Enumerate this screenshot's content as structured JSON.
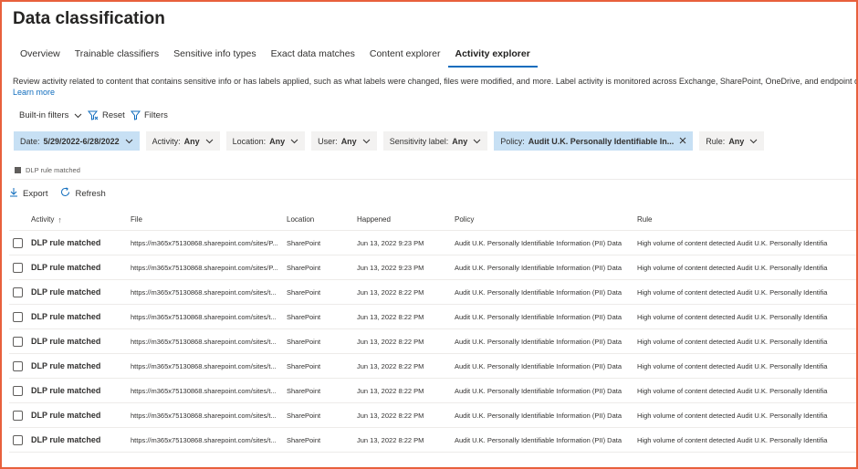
{
  "page": {
    "title": "Data classification",
    "description": "Review activity related to content that contains sensitive info or has labels applied, such as what labels were changed, files were modified, and more. Label activity is monitored across Exchange, SharePoint, OneDrive, and endpoint devices.",
    "learn_more": "Learn more"
  },
  "tabs": [
    {
      "label": "Overview"
    },
    {
      "label": "Trainable classifiers"
    },
    {
      "label": "Sensitive info types"
    },
    {
      "label": "Exact data matches"
    },
    {
      "label": "Content explorer"
    },
    {
      "label": "Activity explorer",
      "active": true
    }
  ],
  "commands": {
    "builtin_filters": "Built-in filters",
    "reset": "Reset",
    "filters": "Filters"
  },
  "filter_chips": [
    {
      "label": "Date:",
      "value": "5/29/2022-6/28/2022",
      "selected": true,
      "icon": "chevron-down-icon"
    },
    {
      "label": "Activity:",
      "value": "Any",
      "selected": false,
      "icon": "chevron-down-icon"
    },
    {
      "label": "Location:",
      "value": "Any",
      "selected": false,
      "icon": "chevron-down-icon"
    },
    {
      "label": "User:",
      "value": "Any",
      "selected": false,
      "icon": "chevron-down-icon"
    },
    {
      "label": "Sensitivity label:",
      "value": "Any",
      "selected": false,
      "icon": "chevron-down-icon"
    },
    {
      "label": "Policy:",
      "value": "Audit U.K. Personally Identifiable In...",
      "selected": true,
      "icon": "close-icon"
    },
    {
      "label": "Rule:",
      "value": "Any",
      "selected": false,
      "icon": "chevron-down-icon"
    }
  ],
  "legend": {
    "label": "DLP rule matched"
  },
  "toolbar": {
    "export": "Export",
    "refresh": "Refresh"
  },
  "table": {
    "columns": [
      "Activity",
      "File",
      "Location",
      "Happened",
      "Policy",
      "Rule"
    ],
    "rows": [
      {
        "activity": "DLP rule matched",
        "file": "https://m365x75130868.sharepoint.com/sites/P...",
        "location": "SharePoint",
        "happened": "Jun 13, 2022 9:23 PM",
        "policy": "Audit U.K. Personally Identifiable Information (PII) Data",
        "rule": "High volume of content detected Audit U.K. Personally Identifia"
      },
      {
        "activity": "DLP rule matched",
        "file": "https://m365x75130868.sharepoint.com/sites/P...",
        "location": "SharePoint",
        "happened": "Jun 13, 2022 9:23 PM",
        "policy": "Audit U.K. Personally Identifiable Information (PII) Data",
        "rule": "High volume of content detected Audit U.K. Personally Identifia"
      },
      {
        "activity": "DLP rule matched",
        "file": "https://m365x75130868.sharepoint.com/sites/t...",
        "location": "SharePoint",
        "happened": "Jun 13, 2022 8:22 PM",
        "policy": "Audit U.K. Personally Identifiable Information (PII) Data",
        "rule": "High volume of content detected Audit U.K. Personally Identifia"
      },
      {
        "activity": "DLP rule matched",
        "file": "https://m365x75130868.sharepoint.com/sites/t...",
        "location": "SharePoint",
        "happened": "Jun 13, 2022 8:22 PM",
        "policy": "Audit U.K. Personally Identifiable Information (PII) Data",
        "rule": "High volume of content detected Audit U.K. Personally Identifia"
      },
      {
        "activity": "DLP rule matched",
        "file": "https://m365x75130868.sharepoint.com/sites/t...",
        "location": "SharePoint",
        "happened": "Jun 13, 2022 8:22 PM",
        "policy": "Audit U.K. Personally Identifiable Information (PII) Data",
        "rule": "High volume of content detected Audit U.K. Personally Identifia"
      },
      {
        "activity": "DLP rule matched",
        "file": "https://m365x75130868.sharepoint.com/sites/t...",
        "location": "SharePoint",
        "happened": "Jun 13, 2022 8:22 PM",
        "policy": "Audit U.K. Personally Identifiable Information (PII) Data",
        "rule": "High volume of content detected Audit U.K. Personally Identifia"
      },
      {
        "activity": "DLP rule matched",
        "file": "https://m365x75130868.sharepoint.com/sites/t...",
        "location": "SharePoint",
        "happened": "Jun 13, 2022 8:22 PM",
        "policy": "Audit U.K. Personally Identifiable Information (PII) Data",
        "rule": "High volume of content detected Audit U.K. Personally Identifia"
      },
      {
        "activity": "DLP rule matched",
        "file": "https://m365x75130868.sharepoint.com/sites/t...",
        "location": "SharePoint",
        "happened": "Jun 13, 2022 8:22 PM",
        "policy": "Audit U.K. Personally Identifiable Information (PII) Data",
        "rule": "High volume of content detected Audit U.K. Personally Identifia"
      },
      {
        "activity": "DLP rule matched",
        "file": "https://m365x75130868.sharepoint.com/sites/t...",
        "location": "SharePoint",
        "happened": "Jun 13, 2022 8:22 PM",
        "policy": "Audit U.K. Personally Identifiable Information (PII) Data",
        "rule": "High volume of content detected Audit U.K. Personally Identifia"
      }
    ]
  },
  "colors": {
    "accent": "#0f6cbd",
    "selected_chip": "#c7e0f4",
    "frame_border": "#e8603c"
  }
}
